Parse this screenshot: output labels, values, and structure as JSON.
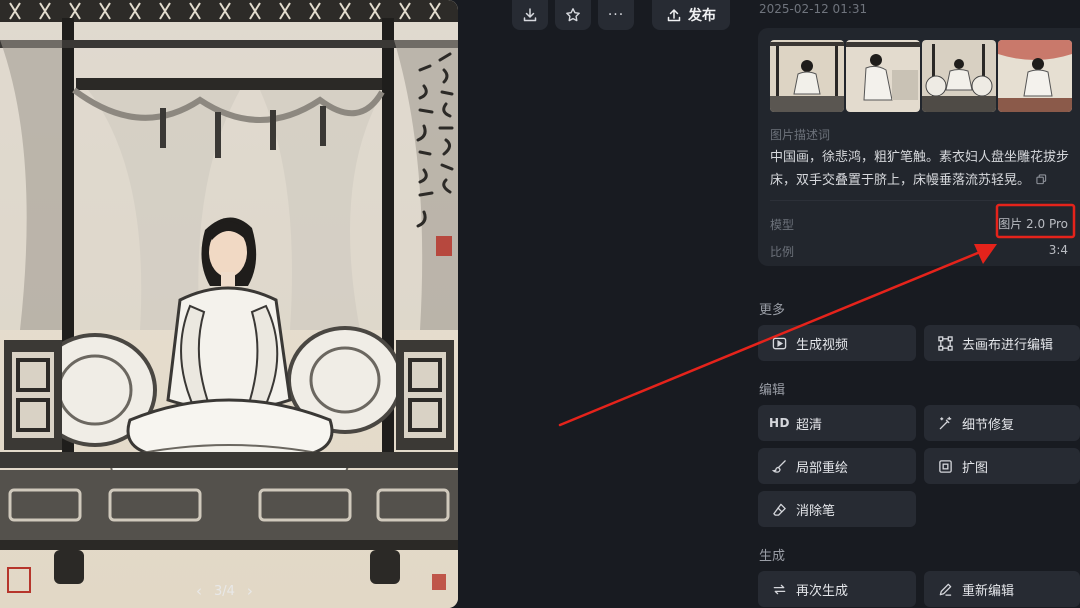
{
  "toolbar": {
    "download_icon": "download-icon",
    "favorite_icon": "star-icon",
    "more_label": "···",
    "publish_label": "发布"
  },
  "pager": {
    "text": "3/4"
  },
  "info": {
    "timestamp": "2025-02-12 01:31",
    "thumbnail_count": 4,
    "prompt_label": "图片描述词",
    "prompt_text": "中国画，徐悲鸿，粗犷笔触。素衣妇人盘坐雕花拔步床，双手交叠置于脐上，床幔垂落流苏轻晃。",
    "model_label": "模型",
    "model_value": "图片 2.0 Pro",
    "ratio_label": "比例",
    "ratio_value": "3:4"
  },
  "sections": {
    "more": {
      "title": "更多",
      "buttons": [
        {
          "label": "生成视频",
          "icon": "video-icon"
        },
        {
          "label": "去画布进行编辑",
          "icon": "canvas-crop-icon"
        }
      ]
    },
    "edit": {
      "title": "编辑",
      "buttons": [
        {
          "label": "超清",
          "icon": "hd-icon",
          "icon_text": "HD"
        },
        {
          "label": "细节修复",
          "icon": "magic-wand-icon"
        },
        {
          "label": "局部重绘",
          "icon": "brush-icon"
        },
        {
          "label": "扩图",
          "icon": "expand-icon"
        },
        {
          "label": "消除笔",
          "icon": "eraser-icon"
        }
      ]
    },
    "generate": {
      "title": "生成",
      "buttons": [
        {
          "label": "再次生成",
          "icon": "regenerate-icon"
        },
        {
          "label": "重新编辑",
          "icon": "pencil-icon"
        }
      ]
    }
  },
  "colors": {
    "background": "#181b21",
    "card": "#22262d",
    "button": "#272b33",
    "annotation": "#e5231b"
  }
}
